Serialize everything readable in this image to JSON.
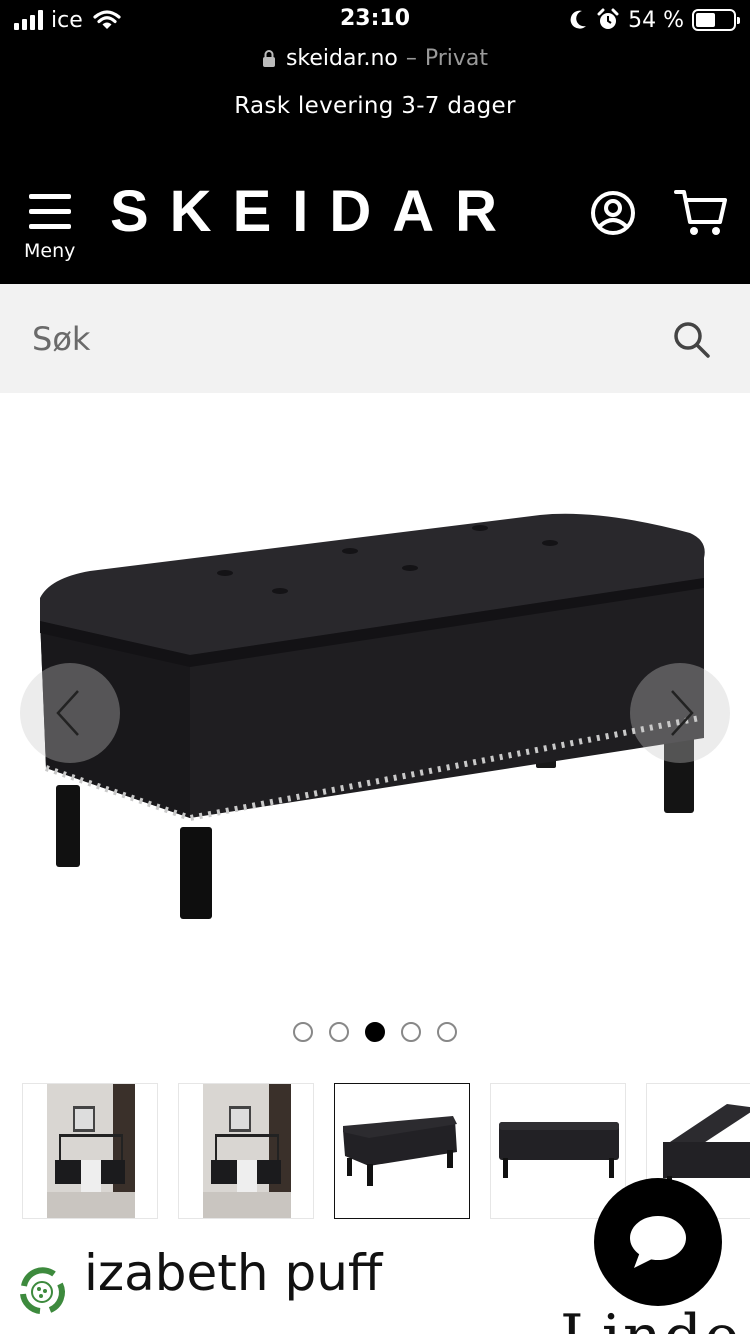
{
  "status_bar": {
    "carrier": "ice",
    "time": "23:10",
    "battery_percent_text": "54 %",
    "battery_level": 0.54,
    "icons": [
      "signal-icon",
      "wifi-icon",
      "moon-icon",
      "alarm-icon",
      "battery-icon"
    ]
  },
  "browser": {
    "domain": "skeidar.no",
    "separator": "–",
    "mode": "Privat"
  },
  "promo": {
    "text": "Rask levering 3-7 dager"
  },
  "header": {
    "menu_label": "Meny",
    "logo_text": "SKEIDAR",
    "icons": [
      "menu-icon",
      "account-icon",
      "cart-icon"
    ]
  },
  "search": {
    "placeholder": "Søk"
  },
  "gallery": {
    "slide_count": 5,
    "active_slide": 3,
    "thumbnails": 5,
    "selected_thumbnail": 3
  },
  "product": {
    "title_visible": "izabeth puff",
    "partial_text": "Linde"
  },
  "colors": {
    "header_bg": "#000000",
    "search_bg": "#f2f2f2",
    "accent_green": "#3d8a3d"
  }
}
